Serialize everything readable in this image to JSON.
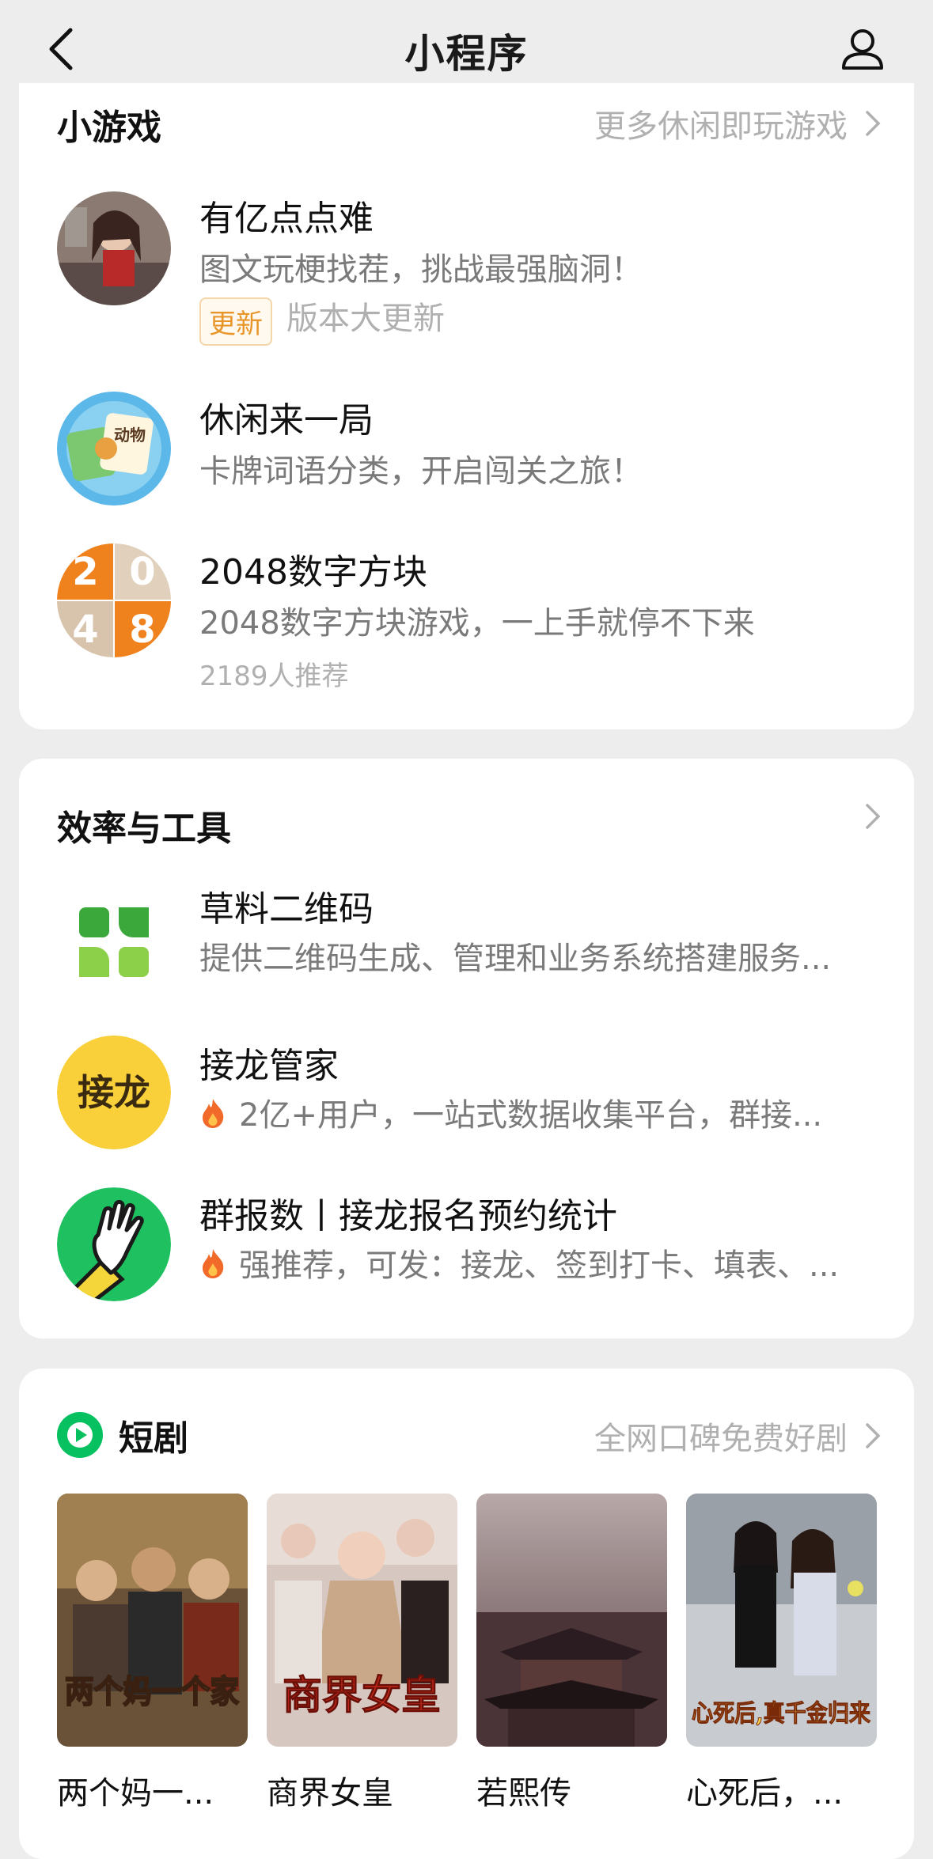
{
  "navbar": {
    "title": "小程序"
  },
  "games": {
    "title": "小游戏",
    "more": "更多休闲即玩游戏",
    "items": [
      {
        "name": "有亿点点难",
        "desc": "图文玩梗找茬，挑战最强脑洞！",
        "tag": "更新",
        "meta": "版本大更新"
      },
      {
        "name": "休闲来一局",
        "desc": "卡牌词语分类，开启闯关之旅！",
        "icon_text": "动物"
      },
      {
        "name": "2048数字方块",
        "desc": "2048数字方块游戏，一上手就停不下来",
        "meta": "2189人推荐",
        "icon_digits": [
          "2",
          "0",
          "4",
          "8"
        ]
      }
    ]
  },
  "tools": {
    "title": "效率与工具",
    "items": [
      {
        "name": "草料二维码",
        "desc": "提供二维码生成、管理和业务系统搭建服务..."
      },
      {
        "name": "接龙管家",
        "desc": "2亿+用户，一站式数据收集平台，群接...",
        "icon_text": "接龙"
      },
      {
        "name": "群报数丨接龙报名预约统计",
        "desc": "强推荐，可发：接龙、签到打卡、填表、..."
      }
    ]
  },
  "dramas": {
    "title": "短剧",
    "more": "全网口碑免费好剧",
    "items": [
      {
        "title": "两个妈一...",
        "poster_text": "两个妈一个家"
      },
      {
        "title": "商界女皇",
        "poster_text": "商界女皇"
      },
      {
        "title": "若熙传",
        "poster_text": ""
      },
      {
        "title": "心死后，...",
        "poster_text": "心死后,真千金归来"
      }
    ]
  },
  "colors": {
    "accent_green": "#07c160",
    "tag_orange": "#e8962a",
    "gray_text": "#7a7a7a"
  }
}
